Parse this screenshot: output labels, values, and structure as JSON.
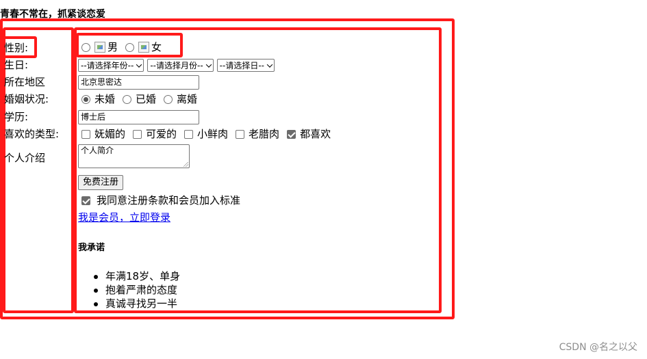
{
  "title": "青春不常在，抓紧谈恋爱",
  "form": {
    "gender": {
      "label": "性别:",
      "options": [
        "男",
        "女"
      ]
    },
    "birthday": {
      "label": "生日:",
      "year": "--请选择年份--",
      "month": "--请选择月份--",
      "day": "--请选择日--"
    },
    "region": {
      "label": "所在地区",
      "value": "北京思密达"
    },
    "marital": {
      "label": "婚姻状况:",
      "options": [
        "未婚",
        "已婚",
        "离婚"
      ],
      "selected": 0
    },
    "education": {
      "label": "学历:",
      "value": "博士后"
    },
    "likes": {
      "label": "喜欢的类型:",
      "options": [
        "妩媚的",
        "可爱的",
        "小鲜肉",
        "老腊肉",
        "都喜欢"
      ],
      "checked": [
        4
      ]
    },
    "intro": {
      "label": "个人介绍",
      "value": "个人简介"
    },
    "submit_label": "免费注册",
    "agree_label": "我同意注册条款和会员加入标准",
    "login_link": "我是会员，立即登录"
  },
  "promise": {
    "heading": "我承诺",
    "items": [
      "年满18岁、单身",
      "抱着严肃的态度",
      "真诚寻找另一半"
    ]
  },
  "watermark": "CSDN @名之以父",
  "colors": {
    "annotation": "#ff1a1a",
    "link": "#0000ee"
  }
}
